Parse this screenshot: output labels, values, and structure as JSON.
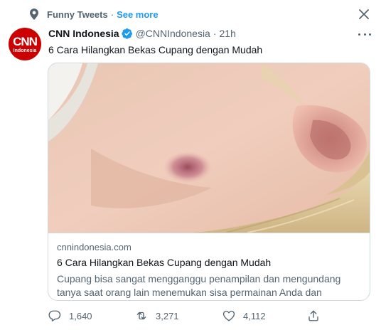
{
  "topic": {
    "icon": "location-pin-icon",
    "name": "Funny Tweets",
    "separator": "·",
    "see_more": "See more",
    "close_icon": "close-icon"
  },
  "tweet": {
    "avatar": {
      "logo_text": "CNN",
      "logo_sub": "Indonesia",
      "brand_color": "#cc0000"
    },
    "author_name": "CNN Indonesia",
    "verified": true,
    "verified_color": "#1d9bf0",
    "handle": "@CNNIndonesia",
    "separator": "·",
    "time": "21h",
    "more_icon": "more-dots-icon",
    "text": "6 Cara Hilangkan Bekas Cupang dengan Mudah"
  },
  "card": {
    "image": "photo-neck-bruise",
    "domain": "cnnindonesia.com",
    "title": "6 Cara Hilangkan Bekas Cupang dengan Mudah",
    "description": "Cupang bisa sangat mengganggu penampilan dan mengundang tanya saat orang lain menemukan sisa permainan Anda dan pasangan"
  },
  "actions": {
    "reply": {
      "icon": "reply-icon",
      "count": "1,640"
    },
    "retweet": {
      "icon": "retweet-icon",
      "count": "3,271"
    },
    "like": {
      "icon": "heart-icon",
      "count": "4,112"
    },
    "share": {
      "icon": "share-icon"
    }
  },
  "colors": {
    "link": "#1d9bf0",
    "secondary_text": "#536471",
    "primary_text": "#0f1419",
    "border": "#cfd9de"
  }
}
